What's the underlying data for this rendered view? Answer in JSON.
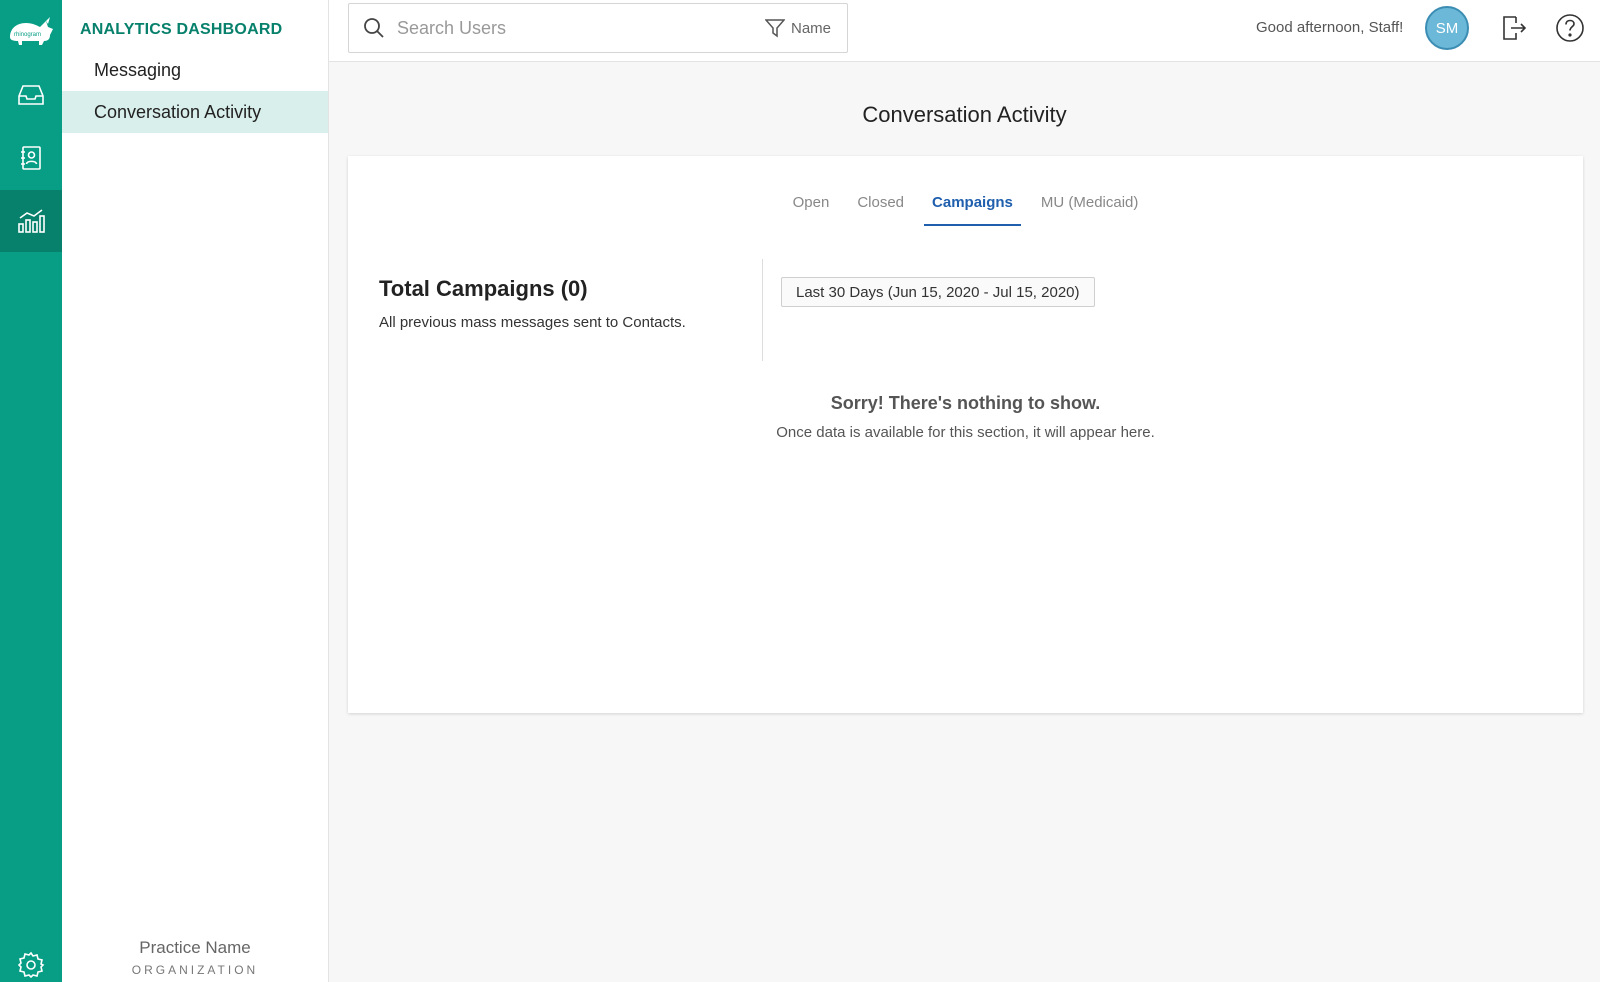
{
  "rail": {
    "logo_text": "rhinogram",
    "icons": [
      "inbox-icon",
      "contacts-icon",
      "analytics-icon",
      "settings-icon"
    ],
    "active": "analytics-icon",
    "color": "#079e85"
  },
  "sidebar": {
    "section_title": "ANALYTICS DASHBOARD",
    "items": [
      {
        "label": "Messaging"
      },
      {
        "label": "Conversation Activity",
        "active": true
      }
    ],
    "practice_name": "Practice Name",
    "organization_label": "ORGANIZATION"
  },
  "header": {
    "search_placeholder": "Search Users",
    "filter_label": "Name",
    "greeting": "Good afternoon, Staff!",
    "avatar_initials": "SM"
  },
  "main": {
    "title": "Conversation Activity",
    "tabs": [
      {
        "label": "Open"
      },
      {
        "label": "Closed"
      },
      {
        "label": "Campaigns",
        "active": true
      },
      {
        "label": "MU (Medicaid)"
      }
    ],
    "summary_title": "Total Campaigns (0)",
    "summary_subtitle": "All previous mass messages sent to Contacts.",
    "date_range": "Last 30 Days (Jun 15, 2020 - Jul 15, 2020)",
    "empty_title": "Sorry! There's nothing to show.",
    "empty_subtitle": "Once data is available for this section, it will appear here."
  },
  "colors": {
    "brand": "#079e85",
    "active_tab": "#1f5fae",
    "sidebar_active": "#d9efeb"
  }
}
